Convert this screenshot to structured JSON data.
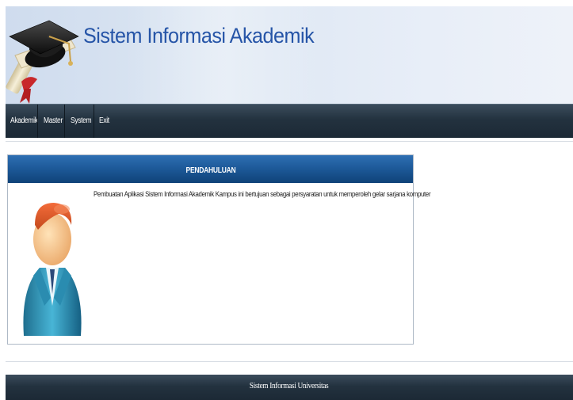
{
  "header": {
    "title": "Sistem Informasi Akademik"
  },
  "menu": {
    "items": [
      {
        "label": "Akademik"
      },
      {
        "label": "Master"
      },
      {
        "label": "System"
      },
      {
        "label": "Exit"
      }
    ]
  },
  "panel": {
    "title": "PENDAHULUAN",
    "text": "Pembuatan Aplikasi Sistem Informasi Akademik Kampus ini bertujuan sebagai persyaratan untuk memperoleh gelar sarjana komputer"
  },
  "footer": {
    "text": "Sistem Informasi Universitas"
  },
  "icons": {
    "logo": "graduation-cap-diploma-icon",
    "avatar": "user-avatar-icon"
  },
  "colors": {
    "title": "#2554a7",
    "menubar": "#23323f",
    "panel_header": "#1c5897"
  }
}
